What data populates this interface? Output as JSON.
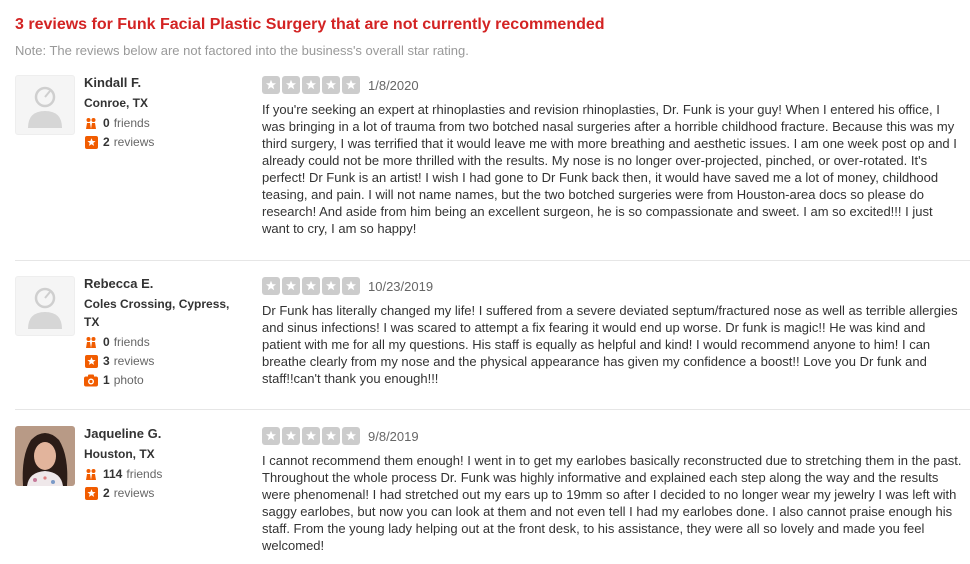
{
  "heading": "3 reviews for Funk Facial Plastic Surgery that are not currently recommended",
  "note": "Note: The reviews below are not factored into the business's overall star rating.",
  "colors": {
    "accent": "#d32323",
    "star_empty": "#cccccc"
  },
  "reviews": [
    {
      "name": "Kindall F.",
      "location": "Conroe, TX",
      "friends_count": "0",
      "friends_label": "friends",
      "reviews_count": "2",
      "reviews_label": "reviews",
      "rating": 0,
      "date": "1/8/2020",
      "text": "If you're seeking an expert at rhinoplasties and revision rhinoplasties, Dr. Funk is your guy! When I entered his office, I was bringing in a lot of trauma from two botched nasal surgeries after a horrible childhood fracture. Because this was my third surgery, I was terrified that it would leave me with more breathing and aesthetic issues. I am one week post op and I already could not be more thrilled with the results. My nose is no longer over-projected, pinched, or over-rotated. It's perfect! Dr Funk is an artist!  I wish I had gone to Dr Funk back then, it would have saved me a lot of money, childhood teasing, and pain. I will not name names, but the two botched surgeries were from Houston-area docs so please do research! And aside from him being an excellent surgeon, he is so compassionate and sweet. I am so excited!!! I just want to cry, I am so happy!"
    },
    {
      "name": "Rebecca E.",
      "location": "Coles Crossing, Cypress, TX",
      "friends_count": "0",
      "friends_label": "friends",
      "reviews_count": "3",
      "reviews_label": "reviews",
      "photos_count": "1",
      "photos_label": "photo",
      "rating": 0,
      "date": "10/23/2019",
      "text": "Dr Funk has literally changed my life! I suffered from a severe deviated septum/fractured nose as well as terrible allergies and sinus infections! I was scared to attempt a fix fearing it would end up worse. Dr funk is magic!! He was kind and patient with me for all my questions. His staff is equally as helpful and kind! I would recommend anyone to him! I can breathe clearly from my nose and the physical appearance has given my confidence a boost!! Love you Dr funk and staff!!can't thank you enough!!!"
    },
    {
      "name": "Jaqueline G.",
      "location": "Houston, TX",
      "friends_count": "114",
      "friends_label": "friends",
      "reviews_count": "2",
      "reviews_label": "reviews",
      "rating": 0,
      "date": "9/8/2019",
      "text": "I cannot recommend them enough! I went in to get my earlobes basically reconstructed due to stretching them in the past. Throughout the whole process Dr. Funk was highly informative and explained each step along the way and the results were phenomenal! I had stretched out my ears up to 19mm so after I decided to no longer wear my jewelry I was left with saggy earlobes, but now you can look at them and not even tell I had my earlobes done. I also cannot praise enough his staff. From the young lady helping out at the front desk, to his assistance, they were all so lovely and made you feel welcomed!"
    }
  ]
}
